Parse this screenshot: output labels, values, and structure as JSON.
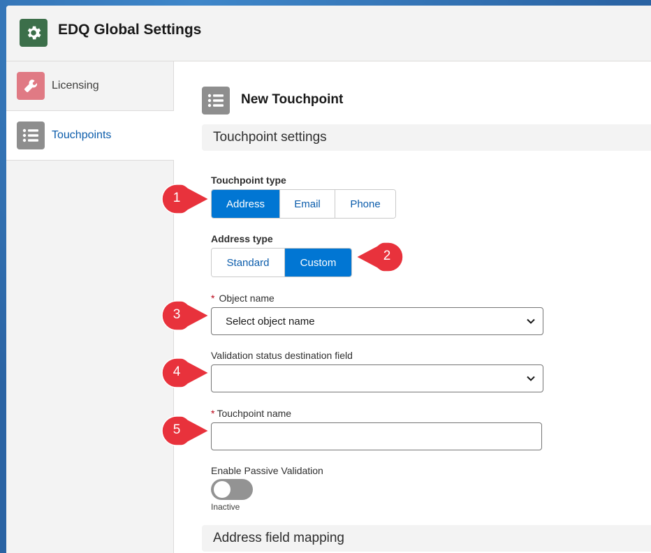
{
  "header": {
    "title": "EDQ Global Settings",
    "icon": "gear-icon"
  },
  "sidebar": {
    "items": [
      {
        "label": "Licensing",
        "icon": "wrench-icon",
        "color": "#e07a84"
      },
      {
        "label": "Touchpoints",
        "icon": "list-icon",
        "color": "#8e8e8e",
        "active": true
      }
    ]
  },
  "main": {
    "title": "New Touchpoint",
    "section_settings": "Touchpoint settings",
    "touchpoint_type": {
      "label": "Touchpoint type",
      "options": [
        "Address",
        "Email",
        "Phone"
      ],
      "selected": "Address"
    },
    "address_type": {
      "label": "Address type",
      "options": [
        "Standard",
        "Custom"
      ],
      "selected": "Custom"
    },
    "object_name": {
      "required_mark": "*",
      "label": "Object name",
      "value": "Select object name"
    },
    "validation_field": {
      "label": "Validation status destination field",
      "value": ""
    },
    "touchpoint_name": {
      "required_mark": "*",
      "label": "Touchpoint name",
      "value": ""
    },
    "passive_validation": {
      "label": "Enable Passive Validation",
      "state": "Inactive",
      "enabled": false
    },
    "section_mapping": "Address field mapping"
  },
  "callouts": [
    "1",
    "2",
    "3",
    "4",
    "5"
  ],
  "colors": {
    "brand": "#0176d3",
    "callout": "#e8323c",
    "app_icon": "#3c6f4a"
  }
}
